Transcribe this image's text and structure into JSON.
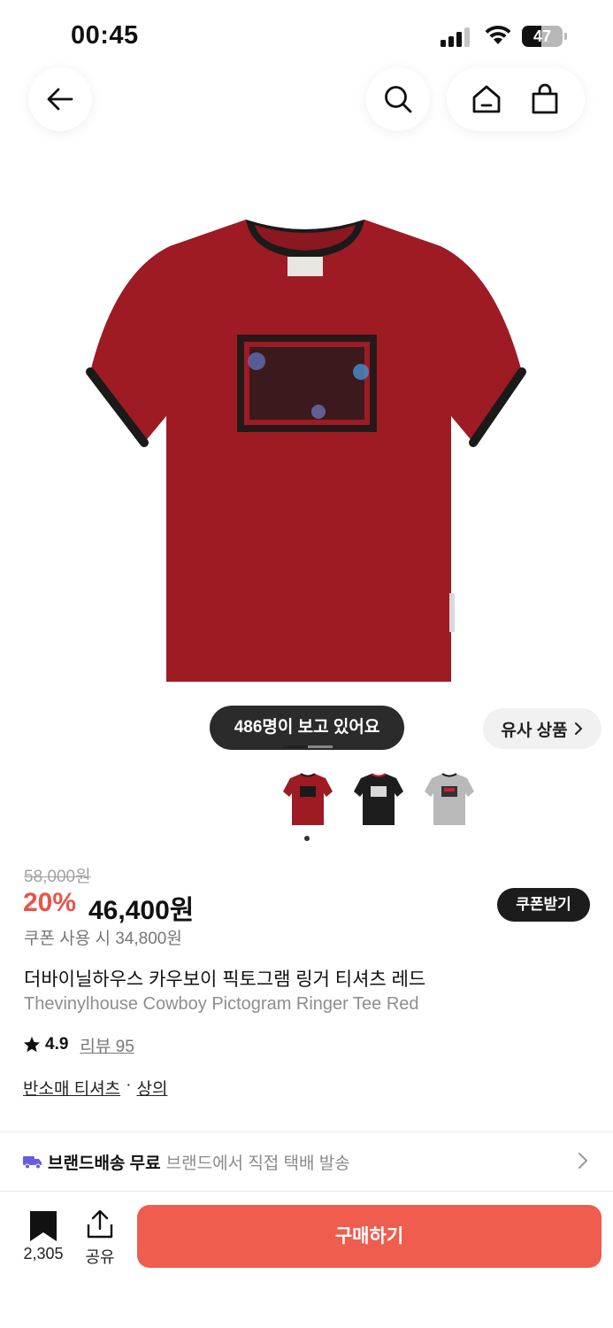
{
  "status_bar": {
    "time": "00:45",
    "battery": "47",
    "battery_level": 0.47
  },
  "nav": {
    "back_icon": "arrow-left-icon",
    "search_icon": "search-icon",
    "home_icon": "home-icon",
    "cart_icon": "shopping-bag-icon"
  },
  "gallery": {
    "viewers_text": "486명이 보고 있어요",
    "similar_label": "유사 상품",
    "thumbnails": [
      "red",
      "black",
      "gray"
    ],
    "colors": {
      "red": "#9e1b24",
      "black": "#1d1d1d",
      "gray": "#b9b9b9"
    }
  },
  "price": {
    "original": "58,000원",
    "discount": "20%",
    "current": "46,400원",
    "coupon_button": "쿠폰받기",
    "coupon_price": "쿠폰 사용 시 34,800원"
  },
  "product": {
    "title_ko": "더바이닐하우스 카우보이 픽토그램 링거 티셔츠 레드",
    "title_en": "Thevinylhouse Cowboy Pictogram Ringer Tee Red",
    "rating": "4.9",
    "review": "리뷰 95",
    "category_1": "반소매 티셔츠",
    "category_sep": "·",
    "category_2": "상의"
  },
  "shipping": {
    "strong": "브랜드배송 무료",
    "sub": "브랜드에서 직접 택배 발송"
  },
  "bottom": {
    "save_count": "2,305",
    "share_label": "공유",
    "buy_label": "구매하기"
  },
  "accent": {
    "discount": "#e8554a",
    "buy_button": "#ef5d4f",
    "truck": "#6b5ce7"
  }
}
